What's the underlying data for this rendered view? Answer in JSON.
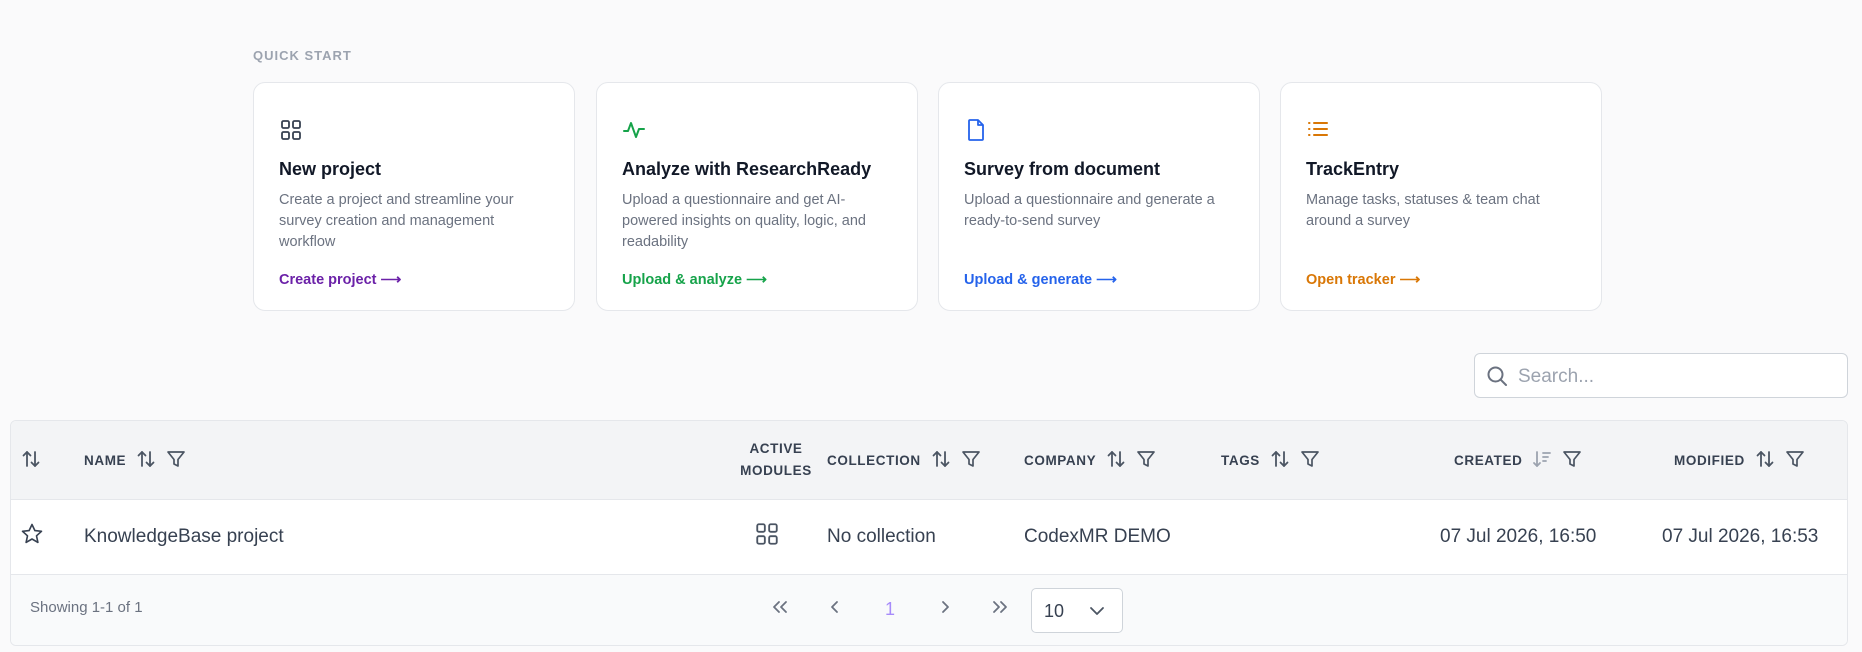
{
  "quick_start": {
    "label": "QUICK START",
    "cards": [
      {
        "title": "New project",
        "description": "Create a project and streamline your survey creation and management workflow",
        "link": "Create project ⟶",
        "color": "#6b21a8",
        "icon": "grid-icon"
      },
      {
        "title": "Analyze with ResearchReady",
        "description": "Upload a questionnaire and get AI-powered insights on quality, logic, and readability",
        "link": "Upload & analyze ⟶",
        "color": "#16a34a",
        "icon": "activity-icon"
      },
      {
        "title": "Survey from document",
        "description": "Upload a questionnaire and generate a ready-to-send survey",
        "link": "Upload & generate ⟶",
        "color": "#2563eb",
        "icon": "document-icon"
      },
      {
        "title": "TrackEntry",
        "description": "Manage tasks, statuses & team chat around a survey",
        "link": "Open tracker ⟶",
        "color": "#d97706",
        "icon": "list-icon"
      }
    ]
  },
  "search": {
    "placeholder": "Search..."
  },
  "table": {
    "columns": {
      "name": "NAME",
      "active_modules_line1": "ACTIVE",
      "active_modules_line2": "MODULES",
      "collection": "COLLECTION",
      "company": "COMPANY",
      "tags": "TAGS",
      "created": "CREATED",
      "modified": "MODIFIED"
    },
    "rows": [
      {
        "name": "KnowledgeBase project",
        "collection": "No collection",
        "company": "CodexMR DEMO",
        "tags": "",
        "created": "07 Jul 2026, 16:50",
        "modified": "07 Jul 2026, 16:53"
      }
    ],
    "footer": {
      "showing": "Showing 1-1 of 1",
      "current_page": "1",
      "page_size": "10"
    }
  },
  "colors": {
    "accent_page": "#a78bfa",
    "header_bg": "#f3f4f6"
  }
}
